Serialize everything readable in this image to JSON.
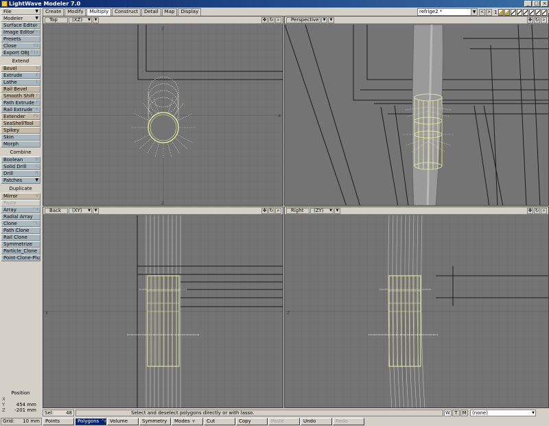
{
  "window": {
    "title": "LightWave Modeler 7.0",
    "buttons": [
      "_",
      "□",
      "×"
    ]
  },
  "tabs": [
    {
      "label": "Create",
      "active": false
    },
    {
      "label": "Modify",
      "active": false
    },
    {
      "label": "Multiply",
      "active": true
    },
    {
      "label": "Construct",
      "active": false
    },
    {
      "label": "Detail",
      "active": false
    },
    {
      "label": "Map",
      "active": false
    },
    {
      "label": "Display",
      "active": false
    }
  ],
  "scene": {
    "object": "refrige2 *",
    "layer_number": "1"
  },
  "toolbar": {
    "file": "File",
    "modeler": "Modeler",
    "surface_editor": "Surface Editor",
    "surface_editor_key": "F5",
    "image_editor": "Image Editor",
    "image_editor_key": "F6",
    "presets": "Presets",
    "close": "Close",
    "close_key": "F3",
    "export_obj": "Export OBJ",
    "export_obj_key": "F11",
    "extend_head": "Extend",
    "extend": [
      {
        "label": "Bevel",
        "key": "b"
      },
      {
        "label": "Extrude",
        "key": "E"
      },
      {
        "label": "Lathe",
        "key": "L"
      },
      {
        "label": "Rail Bevel",
        "key": ""
      },
      {
        "label": "Smooth Shift",
        "key": "F"
      },
      {
        "label": "Path Extrude",
        "key": "P"
      },
      {
        "label": "Rail Extrude",
        "key": "^R"
      },
      {
        "label": "Extender",
        "key": "F9"
      },
      {
        "label": "SeaShellTool",
        "key": ""
      },
      {
        "label": "Spikey",
        "key": ""
      },
      {
        "label": "Skin",
        "key": ""
      },
      {
        "label": "Morph",
        "key": ""
      }
    ],
    "combine_head": "Combine",
    "combine": [
      {
        "label": "Boolean",
        "key": "B"
      },
      {
        "label": "Solid Drill",
        "key": "C"
      },
      {
        "label": "Drill",
        "key": "R"
      }
    ],
    "patches": "Patches",
    "duplicate_head": "Duplicate",
    "mirror": "Mirror",
    "mirror_key": "V",
    "paste": "Paste",
    "duplicate": [
      {
        "label": "Array",
        "key": "^Y"
      },
      {
        "label": "Radial Array",
        "key": ""
      },
      {
        "label": "Clone",
        "key": "^C"
      },
      {
        "label": "Path Clone",
        "key": ""
      },
      {
        "label": "Rail Clone",
        "key": ""
      },
      {
        "label": "Symmetrize",
        "key": ""
      },
      {
        "label": "Particle_Clone",
        "key": ""
      },
      {
        "label": "Point-Clone-Plus+",
        "key": ""
      }
    ]
  },
  "viewports": {
    "top_left": {
      "name": "Top",
      "mode": "(XZ)"
    },
    "top_right": {
      "name": "Perspective",
      "mode": ""
    },
    "bottom_left": {
      "name": "Back",
      "mode": "(XY)"
    },
    "bottom_right": {
      "name": "Right",
      "mode": "(ZY)"
    }
  },
  "position": {
    "title": "Position",
    "x": "",
    "y": "454 mm",
    "z": "-201 mm"
  },
  "status": {
    "sel_label": "Sel:",
    "sel_count": "48",
    "message": "Select and deselect polygons directly or with lasso.",
    "wtm": [
      "W",
      "T",
      "M"
    ],
    "surface": "(none)"
  },
  "bottom": {
    "grid_label": "Grid:",
    "grid_value": "10 mm",
    "points": "Points",
    "polygons": "Polygons",
    "polygons_key": "^H",
    "volume": "Volume",
    "symmetry": "Symmetry",
    "modes": "Modes",
    "cut": "Cut",
    "copy": "Copy",
    "paste": "Paste",
    "undo": "Undo",
    "redo": "Redo"
  },
  "colors": {
    "viewport_bg": "#747474",
    "selection": "#f2f2a0",
    "active_tab": "#0a246a"
  }
}
